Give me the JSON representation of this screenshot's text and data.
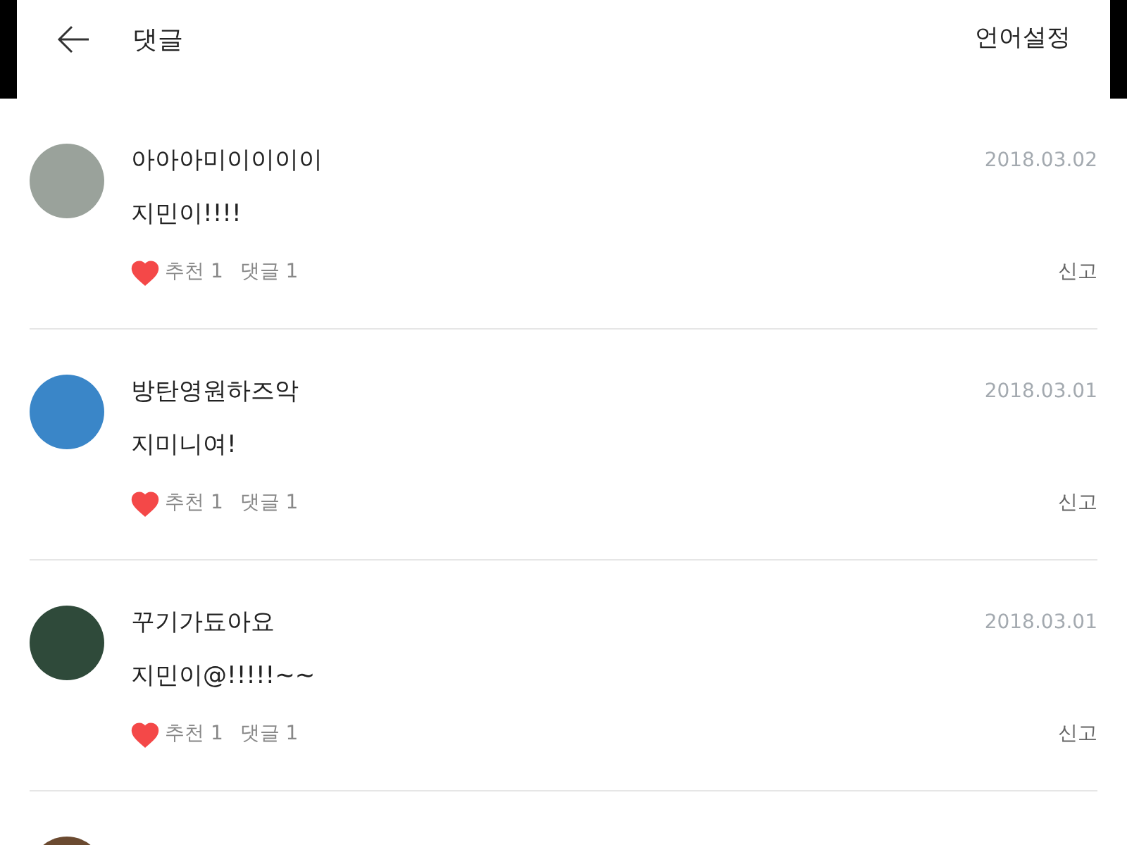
{
  "header": {
    "title": "댓글",
    "action": "언어설정"
  },
  "comments": [
    {
      "author": "아아아미이이이이",
      "date": "2018.03.02",
      "text": "지민이!!!!",
      "liked": true,
      "likes": "추천 1",
      "replies": "댓글 1",
      "report": "신고"
    },
    {
      "author": "방탄영원하즈악",
      "date": "2018.03.01",
      "text": "지미니여!",
      "liked": true,
      "likes": "추천 1",
      "replies": "댓글 1",
      "report": "신고"
    },
    {
      "author": "꾸기가됴아요",
      "date": "2018.03.01",
      "text": "지민이@!!!!!~~",
      "liked": true,
      "likes": "추천 1",
      "replies": "댓글 1",
      "report": "신고"
    }
  ]
}
